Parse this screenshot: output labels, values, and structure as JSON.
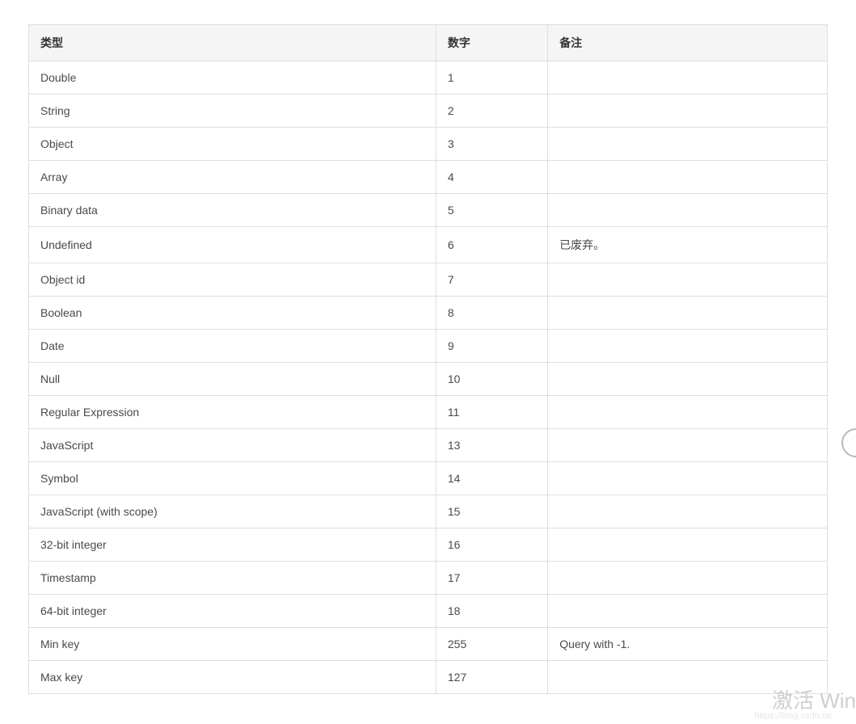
{
  "table": {
    "headers": [
      "类型",
      "数字",
      "备注"
    ],
    "rows": [
      {
        "type": "Double",
        "number": "1",
        "note": ""
      },
      {
        "type": "String",
        "number": "2",
        "note": ""
      },
      {
        "type": "Object",
        "number": "3",
        "note": ""
      },
      {
        "type": "Array",
        "number": "4",
        "note": ""
      },
      {
        "type": "Binary data",
        "number": "5",
        "note": ""
      },
      {
        "type": "Undefined",
        "number": "6",
        "note": "已废弃。"
      },
      {
        "type": "Object id",
        "number": "7",
        "note": ""
      },
      {
        "type": "Boolean",
        "number": "8",
        "note": ""
      },
      {
        "type": "Date",
        "number": "9",
        "note": ""
      },
      {
        "type": "Null",
        "number": "10",
        "note": ""
      },
      {
        "type": "Regular Expression",
        "number": "11",
        "note": ""
      },
      {
        "type": "JavaScript",
        "number": "13",
        "note": ""
      },
      {
        "type": "Symbol",
        "number": "14",
        "note": ""
      },
      {
        "type": "JavaScript (with scope)",
        "number": "15",
        "note": ""
      },
      {
        "type": "32-bit integer",
        "number": "16",
        "note": ""
      },
      {
        "type": "Timestamp",
        "number": "17",
        "note": ""
      },
      {
        "type": "64-bit integer",
        "number": "18",
        "note": ""
      },
      {
        "type": "Min key",
        "number": "255",
        "note": "Query with -1."
      },
      {
        "type": "Max key",
        "number": "127",
        "note": ""
      }
    ]
  },
  "watermark": "激活 Win",
  "watermark_url": "https://blog.csdn.ne",
  "chart_data": {
    "type": "table",
    "title": "",
    "columns": [
      "类型",
      "数字",
      "备注"
    ],
    "rows": [
      [
        "Double",
        1,
        ""
      ],
      [
        "String",
        2,
        ""
      ],
      [
        "Object",
        3,
        ""
      ],
      [
        "Array",
        4,
        ""
      ],
      [
        "Binary data",
        5,
        ""
      ],
      [
        "Undefined",
        6,
        "已废弃。"
      ],
      [
        "Object id",
        7,
        ""
      ],
      [
        "Boolean",
        8,
        ""
      ],
      [
        "Date",
        9,
        ""
      ],
      [
        "Null",
        10,
        ""
      ],
      [
        "Regular Expression",
        11,
        ""
      ],
      [
        "JavaScript",
        13,
        ""
      ],
      [
        "Symbol",
        14,
        ""
      ],
      [
        "JavaScript (with scope)",
        15,
        ""
      ],
      [
        "32-bit integer",
        16,
        ""
      ],
      [
        "Timestamp",
        17,
        ""
      ],
      [
        "64-bit integer",
        18,
        ""
      ],
      [
        "Min key",
        255,
        "Query with -1."
      ],
      [
        "Max key",
        127,
        ""
      ]
    ]
  }
}
